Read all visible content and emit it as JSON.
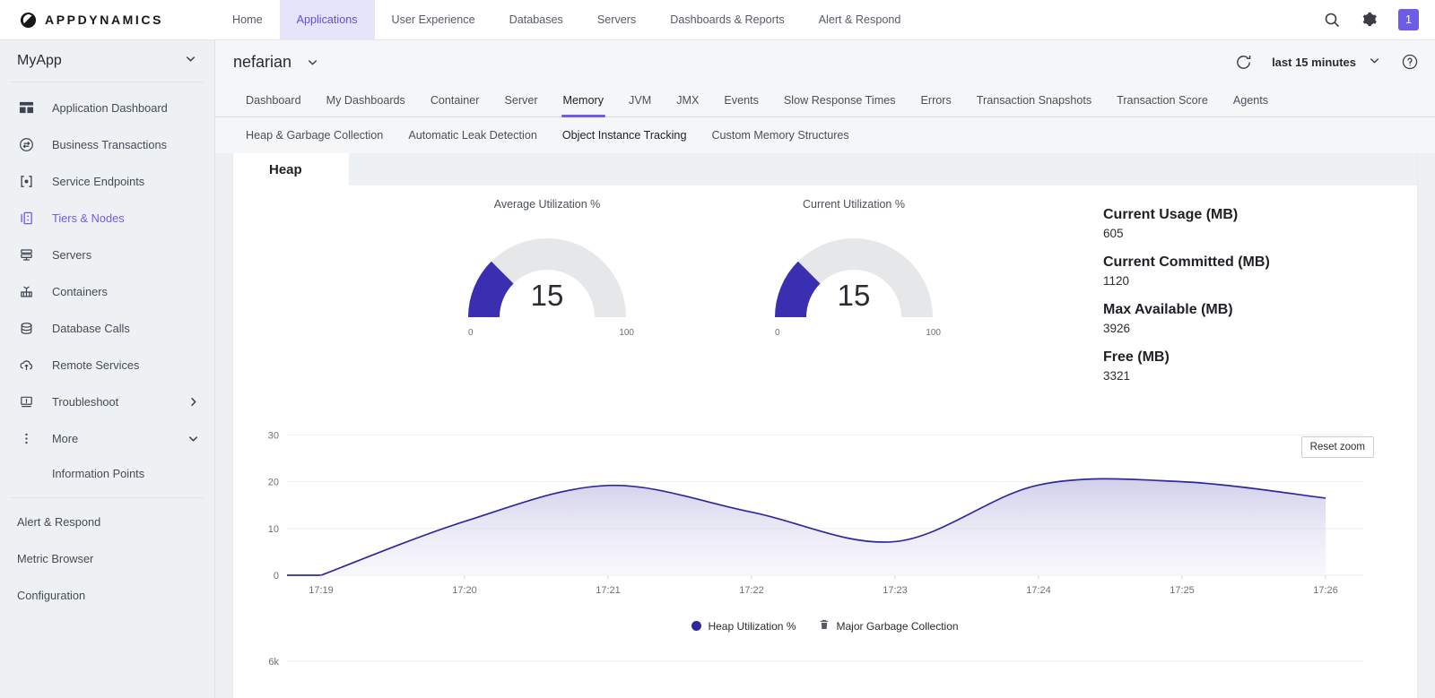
{
  "topbar": {
    "brand": "APPDYNAMICS",
    "brand_icon": "appdynamics-logo-icon",
    "nav": [
      {
        "label": "Home",
        "active": false
      },
      {
        "label": "Applications",
        "active": true
      },
      {
        "label": "User Experience",
        "active": false
      },
      {
        "label": "Databases",
        "active": false
      },
      {
        "label": "Servers",
        "active": false
      },
      {
        "label": "Dashboards & Reports",
        "active": false
      },
      {
        "label": "Alert & Respond",
        "active": false
      }
    ],
    "search_icon": "search-icon",
    "settings_icon": "gear-icon",
    "notification_count": "1",
    "accent_color": "#6c5ce7"
  },
  "sidebar": {
    "app_name": "MyApp",
    "items": [
      {
        "label": "Application Dashboard",
        "icon": "dashboard-grid-icon",
        "active": false
      },
      {
        "label": "Business Transactions",
        "icon": "transactions-arrows-icon",
        "active": false
      },
      {
        "label": "Service Endpoints",
        "icon": "service-endpoint-icon",
        "active": false
      },
      {
        "label": "Tiers & Nodes",
        "icon": "tiers-nodes-icon",
        "active": true
      },
      {
        "label": "Servers",
        "icon": "servers-stack-icon",
        "active": false
      },
      {
        "label": "Containers",
        "icon": "container-icon",
        "active": false
      },
      {
        "label": "Database Calls",
        "icon": "database-icon",
        "active": false
      },
      {
        "label": "Remote Services",
        "icon": "cloud-upload-icon",
        "active": false
      },
      {
        "label": "Troubleshoot",
        "icon": "troubleshoot-monitor-icon",
        "active": false,
        "chevron": "chevron-right-icon"
      },
      {
        "label": "More",
        "icon": "more-vertical-dots-icon",
        "active": false,
        "chevron": "chevron-down-icon"
      }
    ],
    "sub_item": "Information Points",
    "footer_items": [
      "Alert & Respond",
      "Metric Browser",
      "Configuration"
    ]
  },
  "header": {
    "title": "nefarian",
    "title_caret_icon": "chevron-down-icon",
    "refresh_icon": "refresh-icon",
    "time_range": "last 15 minutes",
    "time_caret_icon": "chevron-down-icon",
    "help_icon": "help-circle-icon"
  },
  "tabs": [
    {
      "label": "Dashboard",
      "active": false
    },
    {
      "label": "My Dashboards",
      "active": false
    },
    {
      "label": "Container",
      "active": false
    },
    {
      "label": "Server",
      "active": false
    },
    {
      "label": "Memory",
      "active": true
    },
    {
      "label": "JVM",
      "active": false
    },
    {
      "label": "JMX",
      "active": false
    },
    {
      "label": "Events",
      "active": false
    },
    {
      "label": "Slow Response Times",
      "active": false
    },
    {
      "label": "Errors",
      "active": false
    },
    {
      "label": "Transaction Snapshots",
      "active": false
    },
    {
      "label": "Transaction Score",
      "active": false
    },
    {
      "label": "Agents",
      "active": false
    }
  ],
  "subtabs": [
    {
      "label": "Heap & Garbage Collection",
      "active": false
    },
    {
      "label": "Automatic Leak Detection",
      "active": false
    },
    {
      "label": "Object Instance Tracking",
      "active": true
    },
    {
      "label": "Custom Memory Structures",
      "active": false
    }
  ],
  "panel": {
    "tab_label": "Heap",
    "gauges": [
      {
        "title": "Average Utilization %",
        "value": "15",
        "min": "0",
        "max": "100"
      },
      {
        "title": "Current Utilization %",
        "value": "15",
        "min": "0",
        "max": "100"
      }
    ],
    "metrics": [
      {
        "label": "Current Usage (MB)",
        "value": "605"
      },
      {
        "label": "Current Committed (MB)",
        "value": "1120"
      },
      {
        "label": "Max Available (MB)",
        "value": "3926"
      },
      {
        "label": "Free (MB)",
        "value": "3321"
      }
    ],
    "reset_zoom_label": "Reset zoom",
    "legend": [
      {
        "label": "Heap Utilization %",
        "marker": "circle",
        "color": "#2f2a9c"
      },
      {
        "label": "Major Garbage Collection",
        "marker": "gc-icon",
        "color": "#5a5a62"
      }
    ]
  },
  "chart_data": [
    {
      "type": "area",
      "title": "Heap Utilization %",
      "xlabel": "",
      "ylabel": "",
      "grid": true,
      "legend_position": "bottom",
      "ylim": [
        0,
        32
      ],
      "yticks": [
        0,
        10,
        20,
        30
      ],
      "x": [
        "17:19",
        "17:20",
        "17:21",
        "17:22",
        "17:23",
        "17:24",
        "17:25",
        "17:26"
      ],
      "xticks": [
        "17:19",
        "17:20",
        "17:21",
        "17:22",
        "17:23",
        "17:24",
        "17:25",
        "17:26"
      ],
      "series": [
        {
          "name": "Heap Utilization %",
          "color": "#2f2a9c",
          "values": [
            0,
            11.5,
            19.2,
            13.5,
            7.2,
            19.3,
            20.0,
            16.5
          ]
        }
      ]
    },
    {
      "type": "area",
      "title": "",
      "yticks": [
        6000
      ],
      "ytick_labels": [
        "6k"
      ],
      "series": []
    }
  ]
}
